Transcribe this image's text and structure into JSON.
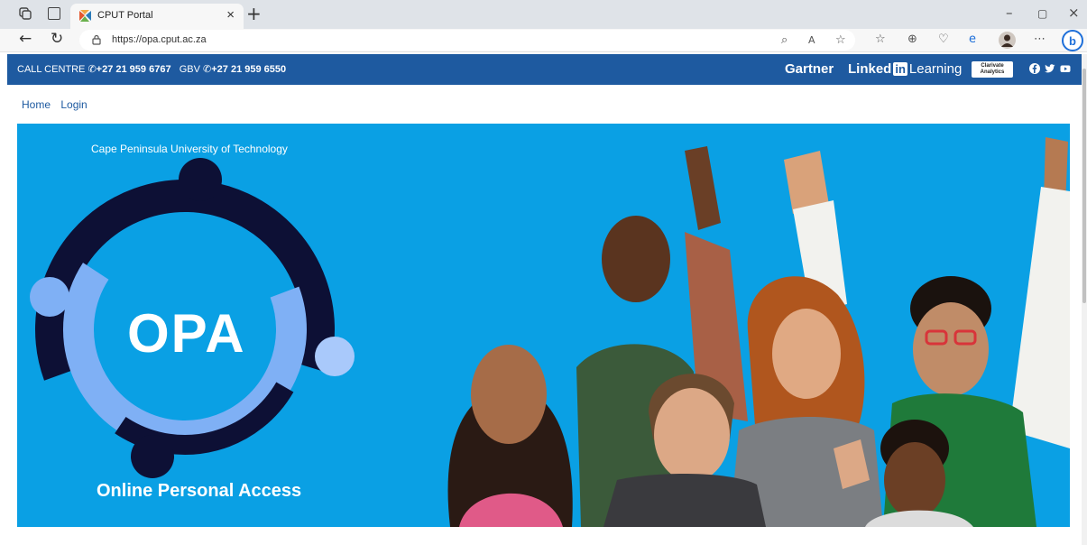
{
  "browser": {
    "tab_title": "CPUT Portal",
    "url": "https://opa.cput.ac.za"
  },
  "banner": {
    "call_centre_label": "CALL CENTRE",
    "call_centre_number": "+27 21 959 6767",
    "gbv_label": "GBV",
    "gbv_number": "+27 21 959 6550",
    "gartner": "Gartner",
    "linkedin_prefix": "Linked",
    "linkedin_in": "in",
    "linkedin_learning": "Learning",
    "clarivate_line1": "Clarivate",
    "clarivate_line2": "Analytics",
    "accent_color": "#1e5aa0"
  },
  "nav": {
    "home": "Home",
    "login": "Login"
  },
  "hero": {
    "university": "Cape Peninsula University of Technology",
    "logo_text": "OPA",
    "caption": "Online Personal Access",
    "background_color": "#0aa0e4"
  }
}
